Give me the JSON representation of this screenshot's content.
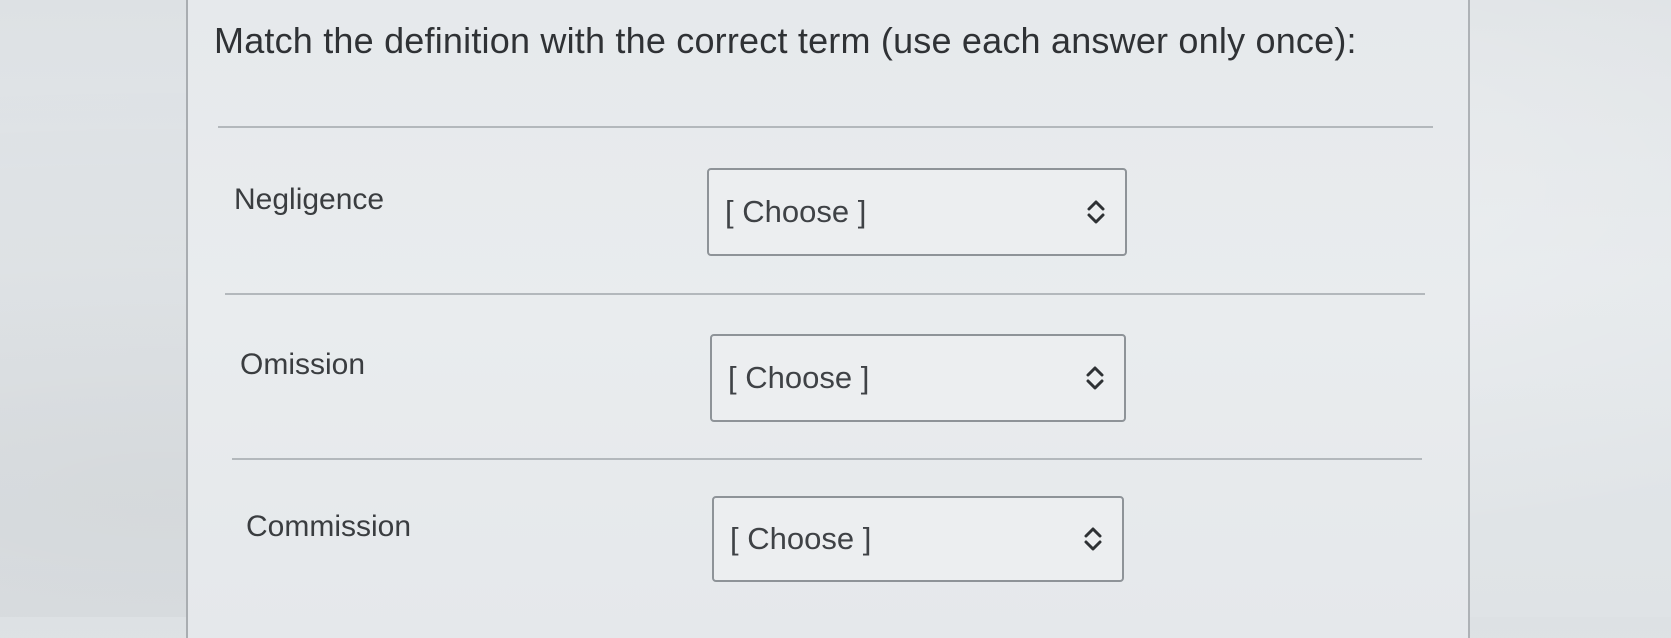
{
  "question": {
    "title": "Match the definition with the correct term (use each answer only once):"
  },
  "rows": [
    {
      "label": "Negligence",
      "select": {
        "value": "[ Choose ]",
        "icon": "updown-chevron-icon"
      }
    },
    {
      "label": "Omission",
      "select": {
        "value": "[ Choose ]",
        "icon": "updown-chevron-icon"
      }
    },
    {
      "label": "Commission",
      "select": {
        "value": "[ Choose ]",
        "icon": "updown-chevron-icon"
      }
    }
  ],
  "colors": {
    "background": "#e3e7ea",
    "text": "#3a3d40",
    "border": "#8e9398",
    "divider": "#b3b8bc"
  }
}
